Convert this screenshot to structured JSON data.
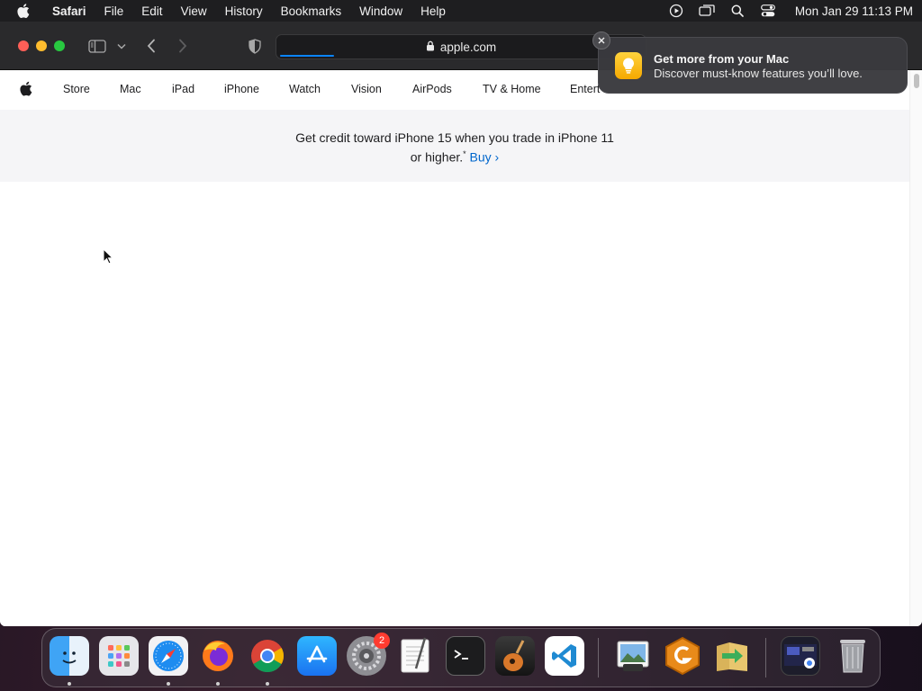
{
  "menubar": {
    "app_name": "Safari",
    "items": [
      "File",
      "Edit",
      "View",
      "History",
      "Bookmarks",
      "Window",
      "Help"
    ],
    "clock": "Mon Jan 29  11:13 PM"
  },
  "browser": {
    "url": "apple.com"
  },
  "globalnav": {
    "links": [
      "Store",
      "Mac",
      "iPad",
      "iPhone",
      "Watch",
      "Vision",
      "AirPods",
      "TV & Home",
      "Entert"
    ]
  },
  "ribbon": {
    "line1": "Get credit toward iPhone 15 when you trade in iPhone 11",
    "line2": "or higher.",
    "footnote": "*",
    "link": "Buy ›"
  },
  "notification": {
    "title": "Get more from your Mac",
    "body": "Discover must-know features you’ll love."
  },
  "dock": {
    "settings_badge": "2",
    "apps": [
      "finder-icon",
      "launchpad-icon",
      "safari-icon",
      "firefox-icon",
      "chrome-icon",
      "app-store-icon",
      "system-settings-icon",
      "textedit-icon",
      "terminal-icon",
      "garageband-icon",
      "vscode-icon",
      "preview-icon",
      "gimp-icon",
      "migration-icon",
      "screenshot-folder-icon",
      "trash-icon"
    ]
  },
  "colors": {
    "link": "#0066cc",
    "accent": "#0a84ff"
  }
}
